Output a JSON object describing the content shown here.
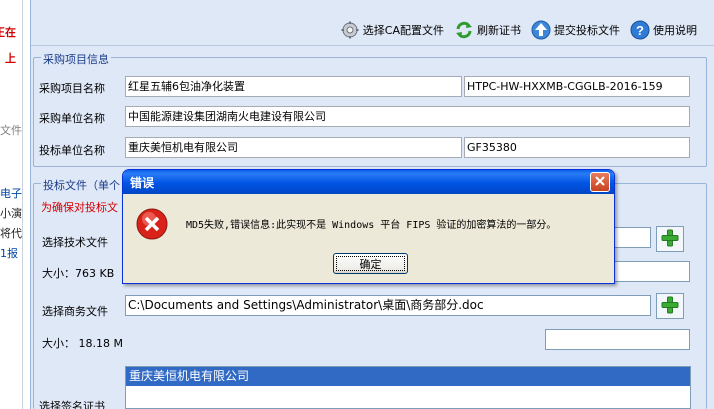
{
  "left_panel": {
    "items": [
      "正在",
      "上",
      "文件",
      "电子",
      "小演",
      "将代",
      "1报"
    ]
  },
  "toolbar": {
    "select_ca": "选择CA配置文件",
    "refresh_cert": "刷新证书",
    "submit_bid": "提交投标文件",
    "help": "使用说明"
  },
  "project": {
    "legend": "采购项目信息",
    "name_label": "采购项目名称",
    "name_value": "红星五辅6包油净化装置",
    "code_value": "HTPC-HW-HXXMB-CGGLB-2016-159",
    "buyer_label": "采购单位名称",
    "buyer_value": "中国能源建设集团湖南火电建设有限公司",
    "bidder_label": "投标单位名称",
    "bidder_value": "重庆美恒机电有限公司",
    "bidder_code": "GF35380"
  },
  "bid_files": {
    "legend": "投标文件（单个",
    "notice": "为确保对投标文",
    "tech_label": "选择技术文件",
    "tech_value": "",
    "tech_size_label": "大小：763 KB",
    "tech_size_field": "",
    "business_label": "选择商务文件",
    "business_value": "C:\\Documents and Settings\\Administrator\\桌面\\商务部分.doc",
    "business_size_label": "大小：  18.18 M",
    "business_size_field": "",
    "sign_label": "选择签名证书",
    "cert_list": [
      "重庆美恒机电有限公司"
    ]
  },
  "dialog": {
    "title": "错误",
    "message": "MD5失败,错误信息:此实现不是 Windows 平台 FIPS 验证的加密算法的一部分。",
    "ok_label": "确定"
  }
}
